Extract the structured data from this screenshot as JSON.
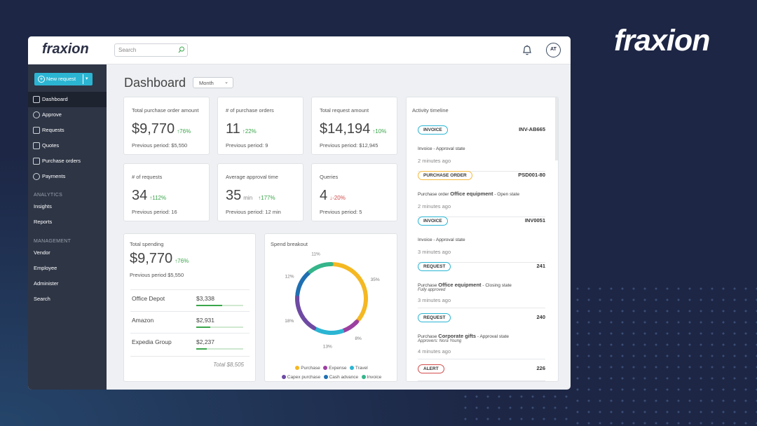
{
  "brand": "fraxion",
  "topbar": {
    "logo": "fraxion",
    "search_placeholder": "Search",
    "user_initials": "AT"
  },
  "sidebar": {
    "new_request": "New request",
    "nav": [
      {
        "label": "Dashboard",
        "icon": "grid-icon"
      },
      {
        "label": "Approve",
        "icon": "check-circle-icon"
      },
      {
        "label": "Requests",
        "icon": "request-icon"
      },
      {
        "label": "Quotes",
        "icon": "quote-icon"
      },
      {
        "label": "Purchase orders",
        "icon": "document-icon"
      },
      {
        "label": "Payments",
        "icon": "dollar-icon"
      }
    ],
    "analytics_title": "ANALYTICS",
    "analytics": [
      "Insights",
      "Reports"
    ],
    "management_title": "MANAGEMENT",
    "management": [
      "Vendor",
      "Employee",
      "Administer",
      "Search"
    ]
  },
  "header": {
    "title": "Dashboard",
    "period": "Month"
  },
  "kpis": [
    {
      "title": "Total purchase order amount",
      "value": "$9,770",
      "change": "76%",
      "dir": "up",
      "prev": "Previous period: $5,550"
    },
    {
      "title": "# of purchase orders",
      "value": "11",
      "change": "22%",
      "dir": "up",
      "prev": "Previous period: 9"
    },
    {
      "title": "Total request amount",
      "value": "$14,194",
      "change": "10%",
      "dir": "up",
      "prev": "Previous period: $12,945"
    },
    {
      "title": "# of requests",
      "value": "34",
      "change": "112%",
      "dir": "up",
      "prev": "Previous period: 16"
    },
    {
      "title": "Average approval time",
      "value": "35",
      "unit": "min",
      "change": "177%",
      "dir": "up",
      "prev": "Previous period: 12 min"
    },
    {
      "title": "Queries",
      "value": "4",
      "change": "-20%",
      "dir": "down",
      "prev": "Previous period: 5"
    }
  ],
  "spending": {
    "title": "Total spending",
    "value": "$9,770",
    "change": "76%",
    "prev": "Previous period $5,550",
    "vendors": [
      {
        "name": "Office Depot",
        "amount": "$3,338",
        "fill": 0.55
      },
      {
        "name": "Amazon",
        "amount": "$2,931",
        "fill": 0.3
      },
      {
        "name": "Expedia Group",
        "amount": "$2,237",
        "fill": 0.22
      }
    ],
    "total": "Total $8,505"
  },
  "chart_data": {
    "type": "pie",
    "title": "Spend breakout",
    "slices": [
      {
        "name": "Purchase",
        "value": 35,
        "color": "#f4b822"
      },
      {
        "name": "Expense",
        "value": 8,
        "color": "#9c3fa1"
      },
      {
        "name": "Travel",
        "value": 13,
        "color": "#2bb5d3"
      },
      {
        "name": "Capex purchase",
        "value": 18,
        "color": "#6e4aa3"
      },
      {
        "name": "Cash advance",
        "value": 12,
        "color": "#1f6fb2"
      },
      {
        "name": "Invoice",
        "value": 11,
        "color": "#35b58a"
      }
    ],
    "labels": [
      "35%",
      "8%",
      "13%",
      "18%",
      "12%",
      "11%"
    ]
  },
  "timeline": {
    "title": "Activity timeline",
    "items": [
      {
        "tag": "INVOICE",
        "style": "blue",
        "id": "INV-AB665",
        "pre": "Invoice",
        "bold": "",
        "post": " - Approval state",
        "sub": "",
        "time": "2 minutes ago"
      },
      {
        "tag": "PURCHASE ORDER",
        "style": "orange",
        "id": "PSD001-80",
        "pre": "Purchase order ",
        "bold": "Office equipment",
        "post": " - Open state",
        "sub": "",
        "time": "2 minutes ago"
      },
      {
        "tag": "INVOICE",
        "style": "blue",
        "id": "INV0051",
        "pre": "Invoice",
        "bold": "",
        "post": " - Approval state",
        "sub": "",
        "time": "3 minutes ago"
      },
      {
        "tag": "REQUEST",
        "style": "blue",
        "id": "241",
        "pre": "Purchase ",
        "bold": "Office equipment",
        "post": " - Closing state",
        "sub": "Fully approved",
        "time": "3 minutes ago"
      },
      {
        "tag": "REQUEST",
        "style": "blue",
        "id": "240",
        "pre": "Purchase ",
        "bold": "Corporate gifts",
        "post": " - Approval state",
        "sub": "Approvers: Nora Young",
        "time": "4 minutes ago"
      },
      {
        "tag": "ALERT",
        "style": "red",
        "id": "226",
        "pre": "",
        "bold": "",
        "post": "",
        "sub": "",
        "time": ""
      }
    ]
  }
}
